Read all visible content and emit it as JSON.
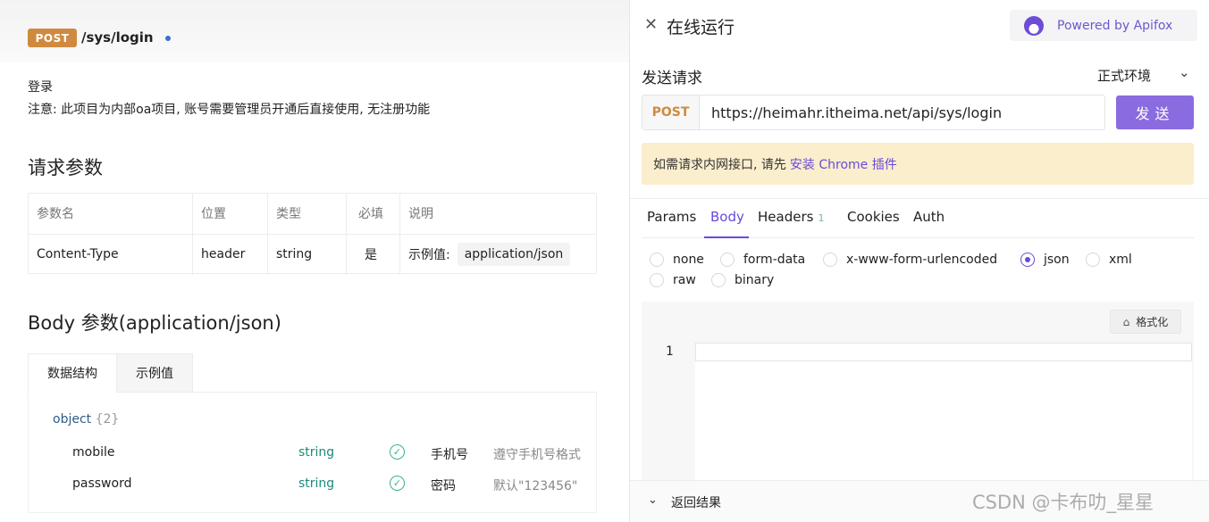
{
  "endpoint": {
    "method": "POST",
    "path": "/sys/login",
    "name": "登录",
    "note": "注意: 此项目为内部oa项目, 账号需要管理员开通后直接使用, 无注册功能"
  },
  "request_params": {
    "title": "请求参数",
    "headers": [
      "参数名",
      "位置",
      "类型",
      "必填",
      "说明"
    ],
    "rows": [
      {
        "name": "Content-Type",
        "location": "header",
        "type": "string",
        "required": "是",
        "example_label": "示例值:",
        "example_value": "application/json"
      }
    ]
  },
  "body_params": {
    "title": "Body 参数(application/json)",
    "tabs": [
      "数据结构",
      "示例值"
    ],
    "root_type": "object",
    "root_count": "{2}",
    "fields": [
      {
        "name": "mobile",
        "type": "string",
        "title": "手机号",
        "desc": "遵守手机号格式"
      },
      {
        "name": "password",
        "type": "string",
        "title": "密码",
        "desc": "默认\"123456\""
      }
    ]
  },
  "run_panel": {
    "title": "在线运行",
    "powered_by": "Powered by Apifox",
    "send_request_label": "发送请求",
    "environment": "正式环境",
    "method": "POST",
    "url": "https://heimahr.itheima.net/api/sys/login",
    "send_button": "发送",
    "notice_text": "如需请求内网接口, 请先",
    "notice_link": "安装 Chrome 插件",
    "tabs": [
      {
        "label": "Params"
      },
      {
        "label": "Body"
      },
      {
        "label": "Headers",
        "badge": "1"
      },
      {
        "label": "Cookies"
      },
      {
        "label": "Auth"
      }
    ],
    "active_tab": "Body",
    "body_types": [
      "none",
      "form-data",
      "x-www-form-urlencoded",
      "json",
      "xml",
      "raw",
      "binary"
    ],
    "selected_body_type": "json",
    "format_button": "格式化",
    "line_number": "1",
    "result_label": "返回结果"
  },
  "watermark": "CSDN @卡布叻_星星",
  "colors": {
    "method_post": "#d08a40",
    "accent": "#6a4ad6",
    "send_button": "#8b6be0",
    "notice_bg": "#fbeecd",
    "type_text": "#1c8a7a"
  }
}
